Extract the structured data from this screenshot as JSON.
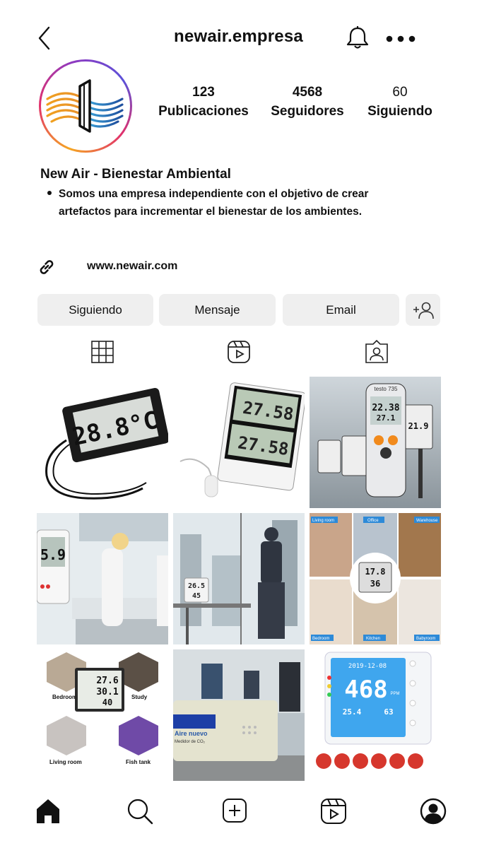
{
  "header": {
    "username": "newair.empresa",
    "icons": [
      "back-icon",
      "bell-icon",
      "more-icon"
    ]
  },
  "profile": {
    "stats": [
      {
        "value": "123",
        "label": "Publicaciones"
      },
      {
        "value": "4568",
        "label": "Seguidores"
      },
      {
        "value": "60",
        "label": "Siguiendo"
      }
    ],
    "name": "New Air - Bienestar Ambiental",
    "bio": "Somos una empresa independiente con el objetivo de crear artefactos para incrementar el bienestar de los ambientes.",
    "link": "www.newair.com"
  },
  "actions": {
    "following": "Siguiendo",
    "message": "Mensaje",
    "email": "Email"
  },
  "tabs": [
    "grid-icon",
    "reels-icon",
    "tagged-icon"
  ],
  "posts": {
    "tile1": {
      "display": "28.8°C"
    },
    "tile2": {
      "top": "27.58",
      "bottom": "27.58"
    },
    "tile3": {
      "main": "22.38",
      "mid": "27.1",
      "right": "21.9",
      "brand": "testo 735"
    },
    "tile4": {
      "reading": "5.9"
    },
    "tile5": {
      "reading1": "26.5",
      "reading2": "45"
    },
    "tile6": {
      "labels": [
        "Living room",
        "Office",
        "Warehouse",
        "Bedroom",
        "Kitchen",
        "Babyroom"
      ],
      "reading1": "17.8",
      "reading2": "36"
    },
    "tile7": {
      "reading1": "27.6",
      "reading2": "30.1",
      "reading3": "40",
      "labels": [
        "Bedroom",
        "Study",
        "Living room",
        "Fish tank"
      ]
    },
    "tile8": {
      "brand": "Aire nuevo",
      "subtitle": "Medidor de CO₂"
    },
    "tile9": {
      "date": "2019-12-08",
      "co2": "468",
      "unit": "PPM",
      "temp": "25.4",
      "hum": "63"
    }
  },
  "nav": [
    "home-icon",
    "search-icon",
    "create-icon",
    "reels-icon",
    "profile-icon"
  ]
}
